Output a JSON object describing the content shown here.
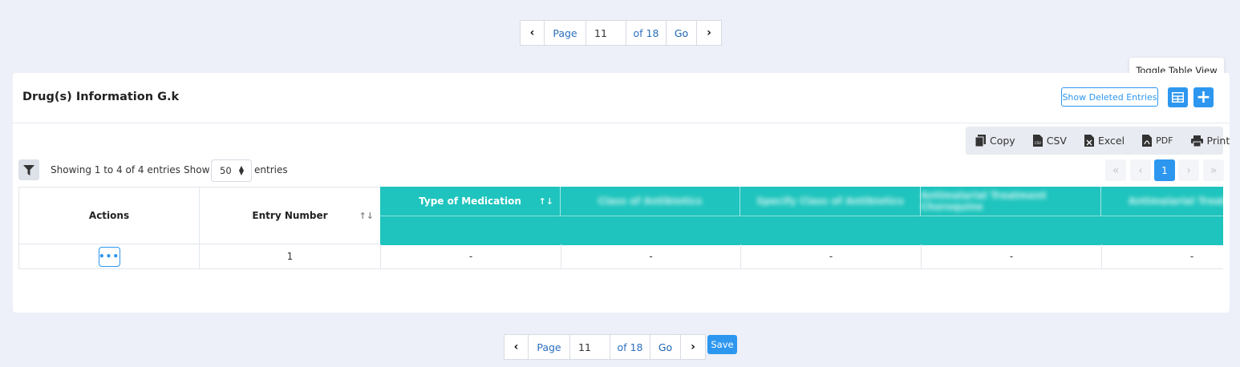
{
  "pager": {
    "page_label": "Page",
    "page_value": "11",
    "of_label": "of 18",
    "go_label": "Go"
  },
  "save_label": "Save",
  "card": {
    "title": "Drug(s) Information G.k",
    "show_deleted_label": "Show Deleted Entries",
    "tooltip": "Toggle Table View"
  },
  "export": {
    "copy": "Copy",
    "csv": "CSV",
    "excel": "Excel",
    "pdf": "PDF",
    "print": "Print"
  },
  "listing": {
    "showing": "Showing 1 to 4 of 4 entries",
    "show_label": "Show",
    "page_size": "50",
    "entries_label": "entries",
    "current_page": "1"
  },
  "table": {
    "headers": {
      "actions": "Actions",
      "entry_number": "Entry Number",
      "type_of_medication": "Type of Medication",
      "class_of_antibiotics": "Class of Antibiotics",
      "specify_class": "Specify Class of Antibiotics",
      "anti_col_1": "Antimalarial Treatment Choroquine",
      "anti_col_2": "Antimalarial Treatment"
    },
    "rows": [
      {
        "entry_number": "1",
        "type": "-",
        "class": "-",
        "specify": "-",
        "anti1": "-",
        "anti2": "-"
      }
    ]
  },
  "colors": {
    "accent": "#2d97f0",
    "teal_header": "#1ec4bd",
    "background": "#edf0f8"
  }
}
